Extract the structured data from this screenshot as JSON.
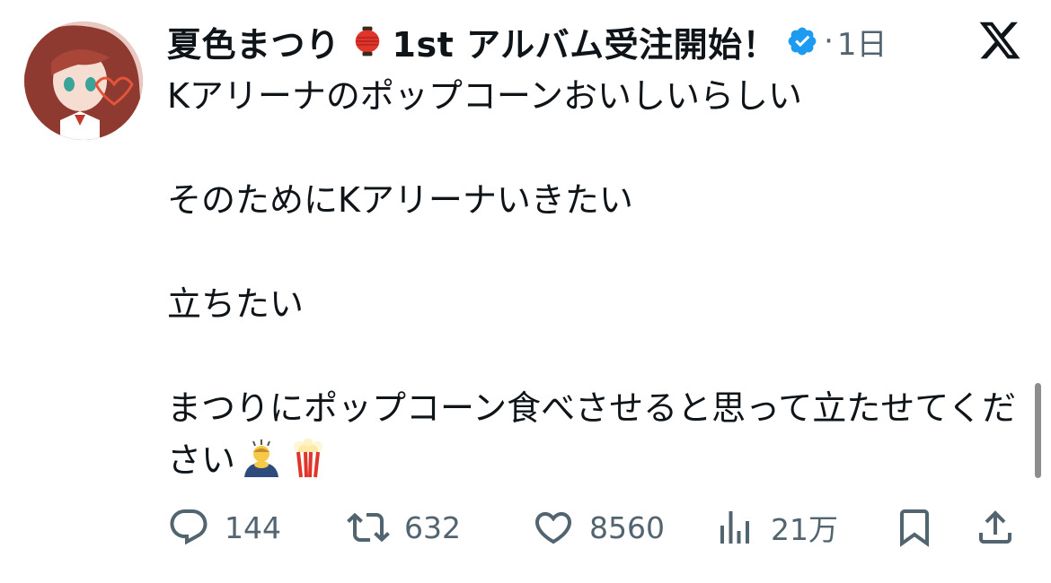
{
  "post": {
    "author_name": "夏色まつり",
    "author_tag": "1st アルバム受注開始！",
    "separator": "·",
    "timestamp": "1日",
    "text": "Kアリーナのポップコーンおいしいらしい\n\nそのためにKアリーナいきたい\n\n立ちたい\n\nまつりにポップコーン食べさせると思って立たせてください"
  },
  "icons": {
    "verified": "verified-badge-icon",
    "x_logo": "x-logo-icon",
    "lantern": "red-lantern-emoji",
    "bow": "person-bowing-emoji",
    "popcorn": "popcorn-emoji"
  },
  "colors": {
    "verified": "#1d9bf0",
    "muted": "#536471",
    "text": "#0f1419"
  },
  "actions": {
    "reply": {
      "count": "144"
    },
    "repost": {
      "count": "632"
    },
    "like": {
      "count": "8560"
    },
    "views": {
      "count": "21万"
    }
  }
}
